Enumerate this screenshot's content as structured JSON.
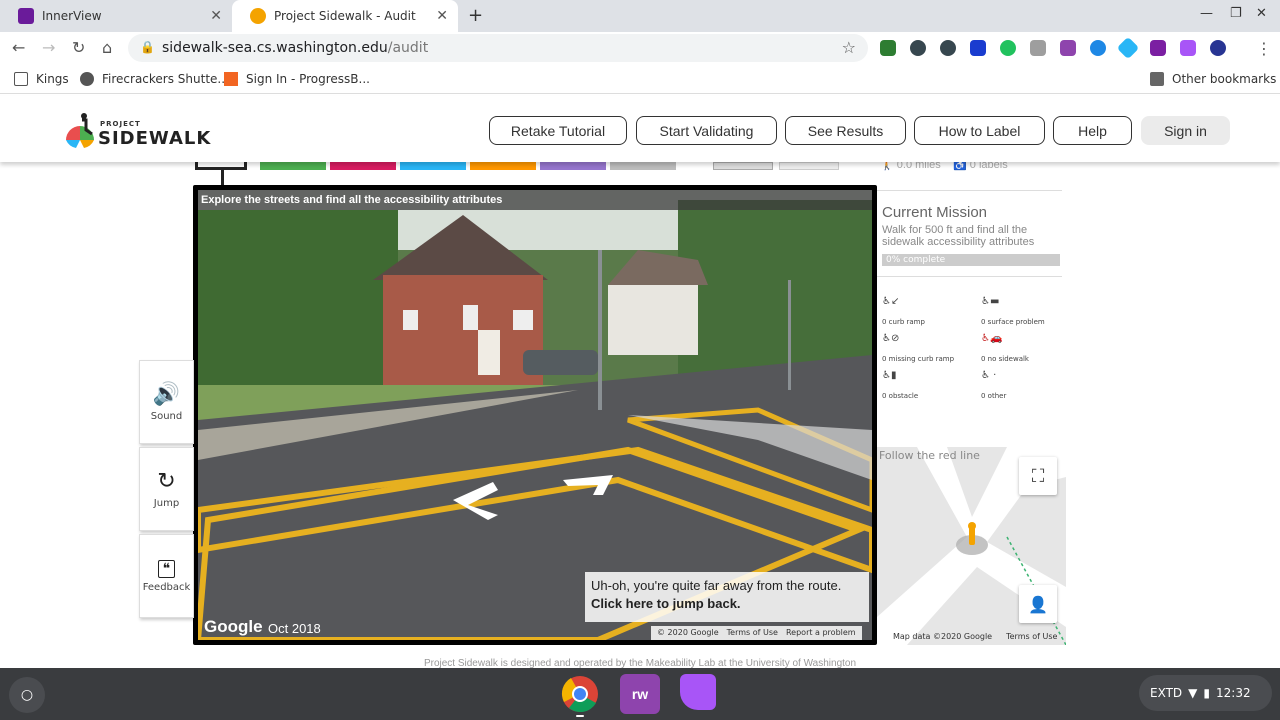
{
  "browser": {
    "tabs": [
      {
        "title": "InnerView",
        "active": false
      },
      {
        "title": "Project Sidewalk - Audit",
        "active": true
      }
    ],
    "url_host": "sidewalk-sea.cs.washington.edu",
    "url_path": "/audit",
    "bookmarks": [
      "Kings",
      "Firecrackers Shutte...",
      "Sign In - ProgressB..."
    ],
    "other_bookmarks": "Other bookmarks"
  },
  "site": {
    "logo_top": "PROJECT",
    "logo_main": "SIDEWALK",
    "nav": [
      "Retake Tutorial",
      "Start Validating",
      "See Results",
      "How to Label",
      "Help",
      "Sign in"
    ],
    "colors": {
      "green": "#4caf50",
      "pink": "#d81b60",
      "blue": "#29b6f6",
      "orange": "#ff9800",
      "purple": "#9575cd",
      "gray": "#bdbdbd"
    }
  },
  "pano": {
    "title": "Explore the streets and find all the accessibility attributes",
    "warning_line1": "Uh-oh, you're quite far away from the route.",
    "warning_line2": "Click here to jump back.",
    "google": "Google",
    "date": "Oct 2018",
    "footer": [
      "© 2020 Google",
      "Terms of Use",
      "Report a problem"
    ]
  },
  "sidebar": {
    "sound": "Sound",
    "jump": "Jump",
    "feedback": "Feedback"
  },
  "right_panel": {
    "distance": "0.0 miles",
    "labels_count": "0 labels",
    "mission_title": "Current Mission",
    "mission_desc": "Walk for 500 ft and find all the sidewalk accessibility attributes",
    "progress_text": "0% complete",
    "progress": 0,
    "label_counts": [
      {
        "text": "0 curb ramp"
      },
      {
        "text": "0 surface problem"
      },
      {
        "text": "0 missing curb ramp"
      },
      {
        "text": "0 no sidewalk"
      },
      {
        "text": "0 obstacle"
      },
      {
        "text": "0 other"
      }
    ]
  },
  "minimap": {
    "caption": "Follow the red line",
    "footer": [
      "Map data ©2020 Google",
      "Terms of Use"
    ]
  },
  "footer_note": "Project Sidewalk is designed and operated by the Makeability Lab at the University of Washington",
  "shelf": {
    "tray_text": "EXTD",
    "time": "12:32"
  }
}
